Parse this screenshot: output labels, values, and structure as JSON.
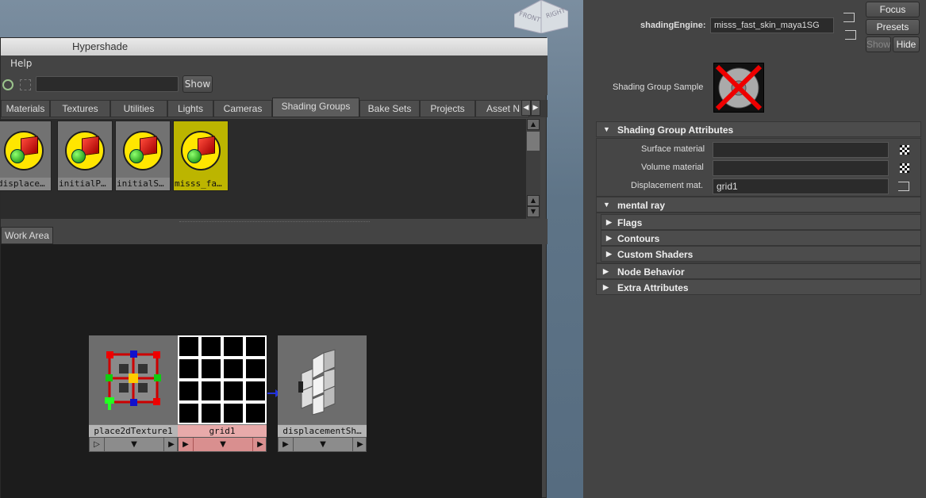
{
  "viewcube": {
    "front": "FRONT",
    "right": "RIGHT"
  },
  "hypershade": {
    "title": "Hypershade",
    "menu": {
      "help": "Help"
    },
    "toolbar": {
      "search_value": "",
      "show_label": "Show"
    },
    "tabs": [
      "Materials",
      "Textures",
      "Utilities",
      "Lights",
      "Cameras",
      "Shading Groups",
      "Bake Sets",
      "Projects",
      "Asset N"
    ],
    "active_tab": "Shading Groups",
    "swatches": [
      {
        "label": "displace…",
        "selected": false
      },
      {
        "label": "initialP…",
        "selected": false
      },
      {
        "label": "initialS…",
        "selected": false
      },
      {
        "label": "misss_fa…",
        "selected": true
      }
    ],
    "work_area_tab": "Work Area",
    "nodes": [
      {
        "name": "place2dTexture1"
      },
      {
        "name": "grid1"
      },
      {
        "name": "displacementSh…"
      }
    ]
  },
  "attribute_editor": {
    "shading_engine_label": "shadingEngine:",
    "shading_engine_value": "misss_fast_skin_maya1SG",
    "focus_label": "Focus",
    "presets_label": "Presets",
    "show_label": "Show",
    "hide_label": "Hide",
    "sample_label": "Shading Group Sample",
    "sections": {
      "sga": "Shading Group Attributes",
      "mental_ray": "mental ray",
      "flags": "Flags",
      "contours": "Contours",
      "custom_shaders": "Custom Shaders",
      "node_behavior": "Node Behavior",
      "extra_attributes": "Extra Attributes"
    },
    "fields": {
      "surface_label": "Surface material",
      "surface_value": "",
      "volume_label": "Volume material",
      "volume_value": "",
      "displacement_label": "Displacement mat.",
      "displacement_value": "grid1"
    }
  }
}
